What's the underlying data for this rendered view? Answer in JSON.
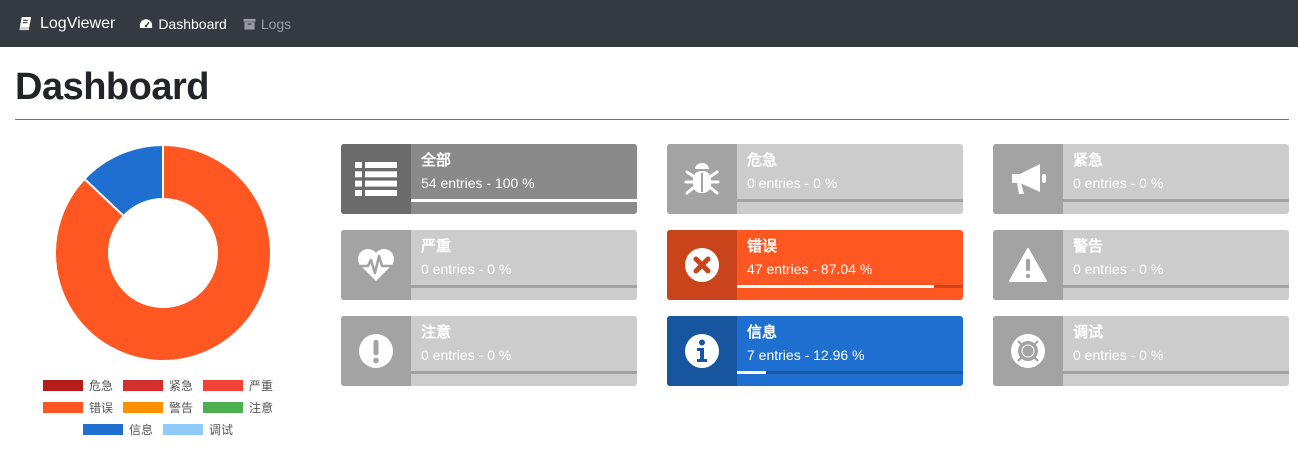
{
  "navbar": {
    "brand": "LogViewer",
    "links": [
      {
        "label": "Dashboard",
        "active": true
      },
      {
        "label": "Logs",
        "active": false
      }
    ]
  },
  "page_title": "Dashboard",
  "chart_data": {
    "type": "pie",
    "style": "doughnut",
    "categories": [
      "危急",
      "紧急",
      "严重",
      "错误",
      "警告",
      "注意",
      "信息",
      "调试"
    ],
    "values": [
      0,
      0,
      0,
      47,
      0,
      0,
      7,
      0
    ],
    "colors": [
      "#b71c1c",
      "#d32f2f",
      "#f44336",
      "#ff5722",
      "#ff9100",
      "#4caf50",
      "#1e6fd0",
      "#90caf9"
    ],
    "legend": "bottom"
  },
  "boxes": [
    {
      "title": "全部",
      "text": "54 entries - 100 %",
      "percent": 100,
      "icon": "list-icon",
      "color": "#8a8a8a",
      "icon_color": "#6b6b6b"
    },
    {
      "title": "危急",
      "text": "0 entries - 0 %",
      "percent": 0,
      "icon": "bug-icon",
      "color": "#cccccc",
      "icon_color": "#a3a3a3"
    },
    {
      "title": "紧急",
      "text": "0 entries - 0 %",
      "percent": 0,
      "icon": "bullhorn-icon",
      "color": "#cccccc",
      "icon_color": "#a3a3a3"
    },
    {
      "title": "严重",
      "text": "0 entries - 0 %",
      "percent": 0,
      "icon": "heartbeat-icon",
      "color": "#cccccc",
      "icon_color": "#a3a3a3"
    },
    {
      "title": "错误",
      "text": "47 entries - 87.04 %",
      "percent": 87.04,
      "icon": "times-circle-icon",
      "color": "#ff5722",
      "icon_color": "#c9441b"
    },
    {
      "title": "警告",
      "text": "0 entries - 0 %",
      "percent": 0,
      "icon": "warning-icon",
      "color": "#cccccc",
      "icon_color": "#a3a3a3"
    },
    {
      "title": "注意",
      "text": "0 entries - 0 %",
      "percent": 0,
      "icon": "exclamation-circle-icon",
      "color": "#cccccc",
      "icon_color": "#a3a3a3"
    },
    {
      "title": "信息",
      "text": "7 entries - 12.96 %",
      "percent": 12.96,
      "icon": "info-circle-icon",
      "color": "#1e6fd0",
      "icon_color": "#17559f"
    },
    {
      "title": "调试",
      "text": "0 entries - 0 %",
      "percent": 0,
      "icon": "life-ring-icon",
      "color": "#cccccc",
      "icon_color": "#a3a3a3"
    }
  ]
}
